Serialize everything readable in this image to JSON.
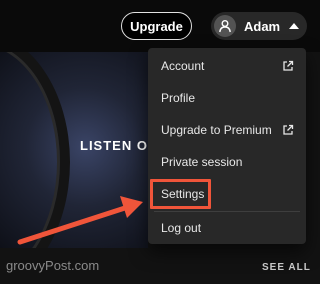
{
  "header": {
    "upgrade_label": "Upgrade",
    "user_name": "Adam"
  },
  "banner": {
    "text": "LISTEN O"
  },
  "menu": {
    "items": [
      {
        "label": "Account",
        "external": true
      },
      {
        "label": "Profile",
        "external": false
      },
      {
        "label": "Upgrade to Premium",
        "external": true
      },
      {
        "label": "Private session",
        "external": false
      },
      {
        "label": "Settings",
        "external": false,
        "highlighted": true
      },
      {
        "label": "Log out",
        "external": false
      }
    ]
  },
  "footer": {
    "see_all": "SEE ALL"
  },
  "watermark": "groovyPost.com",
  "colors": {
    "background": "#121212",
    "menu_background": "#282828",
    "highlight": "#f0553a",
    "text": "#ffffff"
  },
  "icons": [
    "user-icon",
    "caret-up-icon",
    "external-link-icon",
    "arrow-icon"
  ]
}
